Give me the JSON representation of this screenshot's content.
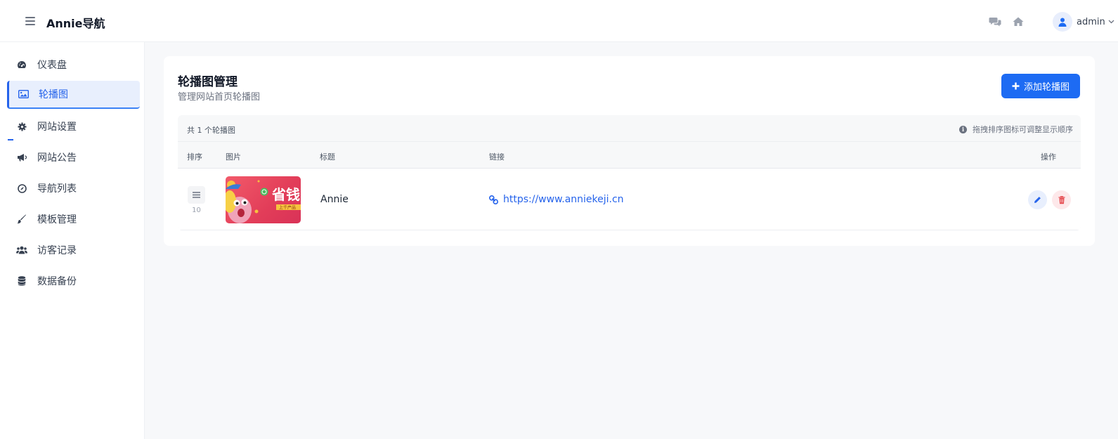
{
  "app": {
    "brand": "Annie导航"
  },
  "header": {
    "user_name": "admin"
  },
  "sidebar": {
    "items": [
      {
        "label": "仪表盘",
        "icon": "gauge-icon"
      },
      {
        "label": "轮播图",
        "icon": "image-icon",
        "active": true
      },
      {
        "label": "网站设置",
        "icon": "gear-icon"
      },
      {
        "label": "网站公告",
        "icon": "megaphone-icon"
      },
      {
        "label": "导航列表",
        "icon": "compass-icon"
      },
      {
        "label": "模板管理",
        "icon": "brush-icon"
      },
      {
        "label": "访客记录",
        "icon": "users-icon"
      },
      {
        "label": "数据备份",
        "icon": "database-icon"
      }
    ]
  },
  "page": {
    "title": "轮播图管理",
    "subtitle": "管理网站首页轮播图",
    "add_button": "添加轮播图"
  },
  "table": {
    "count_text": "共 1 个轮播图",
    "hint": "拖拽排序图标可调整显示顺序",
    "columns": [
      "排序",
      "图片",
      "标题",
      "链接",
      "操作"
    ],
    "rows": [
      {
        "sort": "10",
        "title": "Annie",
        "link": "https://www.anniekeji.cn",
        "image_text": "省钱",
        "image_tag": "上千产品"
      }
    ]
  },
  "colors": {
    "primary": "#1d6bf3",
    "active_bg": "#e8effd",
    "danger": "#e5484d"
  }
}
